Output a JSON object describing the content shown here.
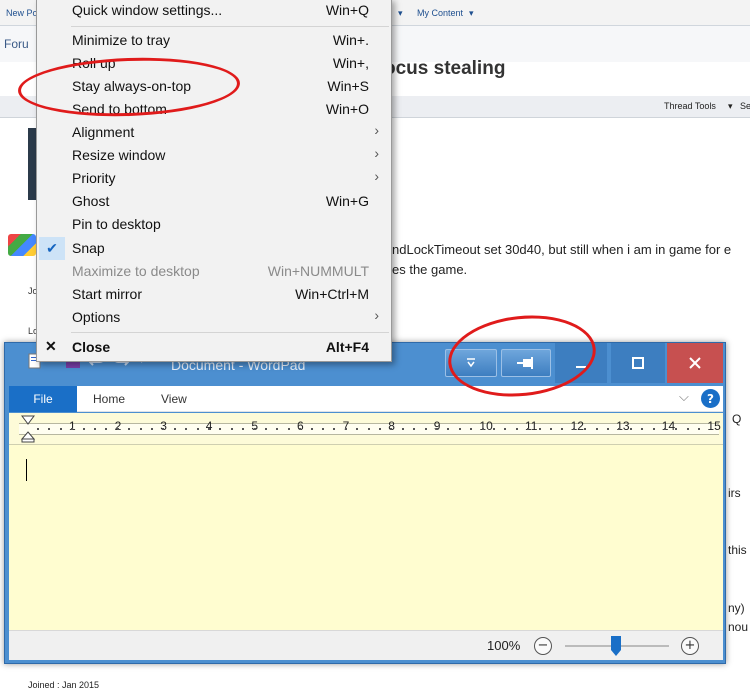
{
  "forum": {
    "topbar_items": [
      "New Po",
      "My Content"
    ],
    "breadcrumb": "Foru",
    "thread_title": "ocus stealing",
    "thread_tools": "Thread Tools",
    "thread_tools_more": "Se",
    "post_line1": "ndLockTimeout set 30d40, but still when i am in game for e",
    "post_line2": "es the game.",
    "side_text_1": "Jo",
    "side_text_2": "Lo",
    "right_frags": [
      "Q",
      "irs",
      "this",
      "ny)",
      "nou"
    ],
    "joined": "Joined : Jan 2015"
  },
  "menu": {
    "items": [
      {
        "label": "Quick window settings...",
        "shortcut": "Win+Q"
      },
      {
        "label": "Minimize to tray",
        "shortcut": "Win+."
      },
      {
        "label": "Roll up",
        "shortcut": "Win+,"
      },
      {
        "label": "Stay always-on-top",
        "shortcut": "Win+S"
      },
      {
        "label": "Send to bottom",
        "shortcut": "Win+O"
      },
      {
        "label": "Alignment",
        "shortcut": ""
      },
      {
        "label": "Resize window",
        "shortcut": ""
      },
      {
        "label": "Priority",
        "shortcut": ""
      },
      {
        "label": "Ghost",
        "shortcut": "Win+G"
      },
      {
        "label": "Pin to desktop",
        "shortcut": ""
      },
      {
        "label": "Snap",
        "shortcut": ""
      },
      {
        "label": "Maximize to desktop",
        "shortcut": "Win+NUMMULT"
      },
      {
        "label": "Start mirror",
        "shortcut": "Win+Ctrl+M"
      },
      {
        "label": "Options",
        "shortcut": ""
      },
      {
        "label": "Close",
        "shortcut": "Alt+F4"
      }
    ]
  },
  "wordpad": {
    "title": "Document - WordPad",
    "tabs": {
      "file": "File",
      "home": "Home",
      "view": "View"
    },
    "help": "?",
    "ruler_numbers": [
      "1",
      "2",
      "3",
      "4",
      "5",
      "6",
      "7",
      "8",
      "9",
      "10",
      "11",
      "12",
      "13",
      "14",
      "15"
    ],
    "zoom": "100%",
    "zoom_level_percent": 100
  },
  "colors": {
    "annotation": "#e01b1b",
    "title_bar": "#4c8fd0",
    "accent": "#1a6fc7",
    "document_bg": "#fffdd0"
  }
}
